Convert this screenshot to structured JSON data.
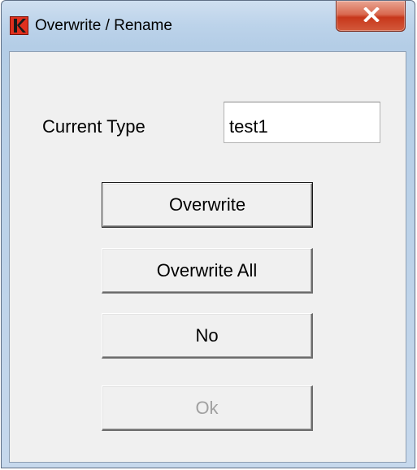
{
  "window": {
    "title": "Overwrite / Rename",
    "app_icon": "k-logo-icon",
    "close_icon": "close-icon"
  },
  "form": {
    "current_type_label": "Current Type",
    "current_type_value": "test1"
  },
  "buttons": {
    "overwrite": "Overwrite",
    "overwrite_all": "Overwrite All",
    "no": "No",
    "ok": "Ok"
  },
  "states": {
    "ok_enabled": false,
    "default_button": "overwrite"
  }
}
